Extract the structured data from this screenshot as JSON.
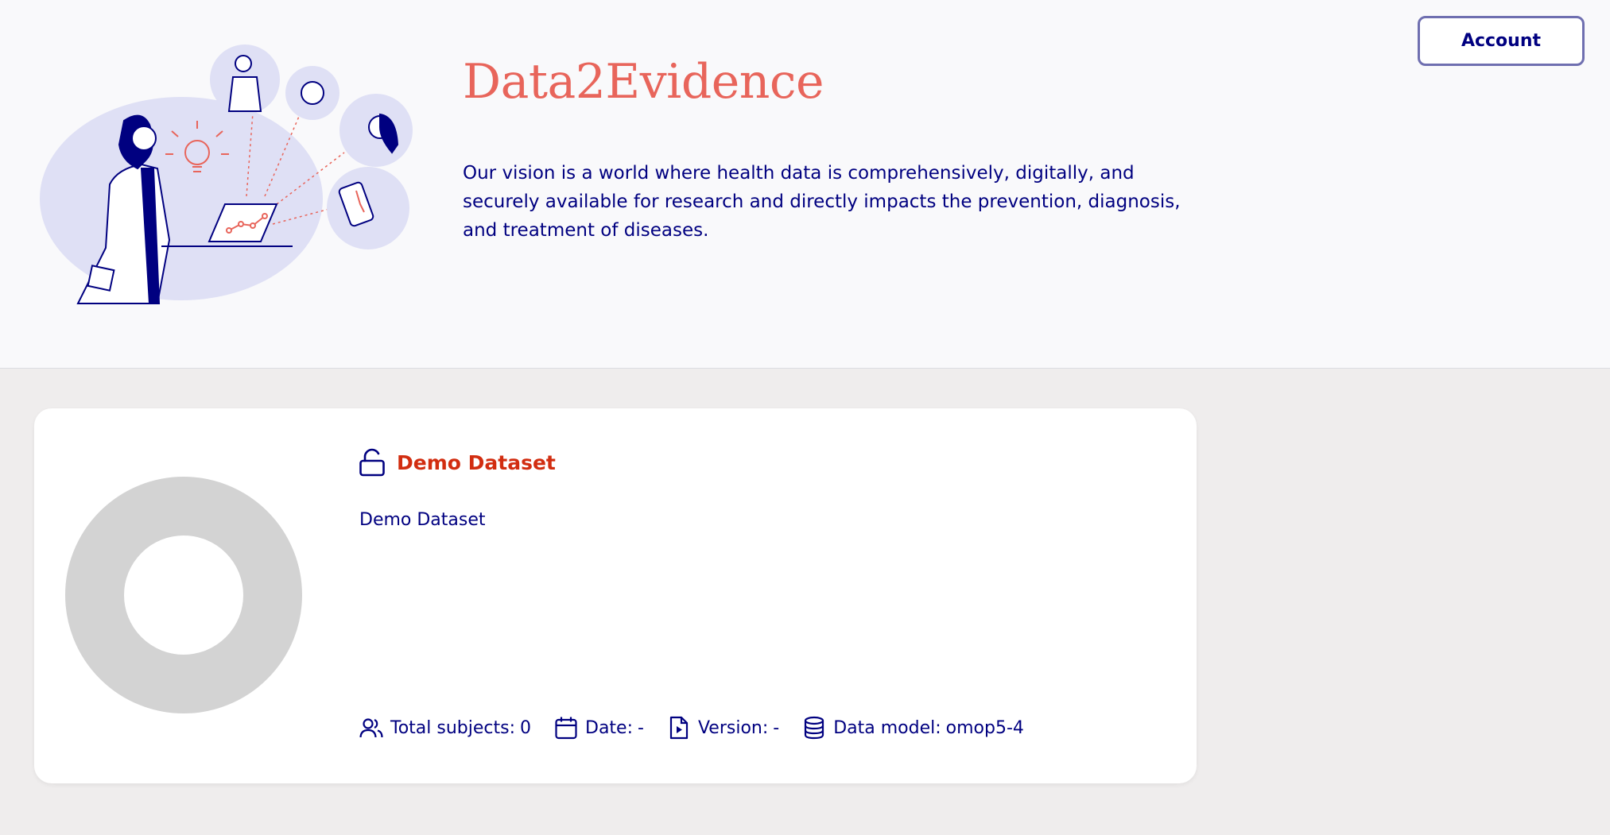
{
  "header": {
    "app_title": "Data2Evidence",
    "vision": "Our vision is a world where health data is comprehensively, digitally, and securely available for research and directly impacts the prevention, diagnosis, and treatment of diseases.",
    "account_label": "Account"
  },
  "colors": {
    "brand_title": "#e8655b",
    "navy": "#000080",
    "dataset_title": "#d22d10",
    "donut_empty": "#d3d3d3",
    "page_bg": "#efeded",
    "header_bg": "#f9f9fb"
  },
  "dataset": {
    "title": "Demo Dataset",
    "description": "Demo Dataset",
    "lock_icon": "lock-open-icon",
    "meta": {
      "total_subjects_label": "Total subjects:",
      "total_subjects_value": "0",
      "date_label": "Date:",
      "date_value": "-",
      "version_label": "Version:",
      "version_value": "-",
      "data_model_label": "Data model:",
      "data_model_value": "omop5-4"
    }
  }
}
